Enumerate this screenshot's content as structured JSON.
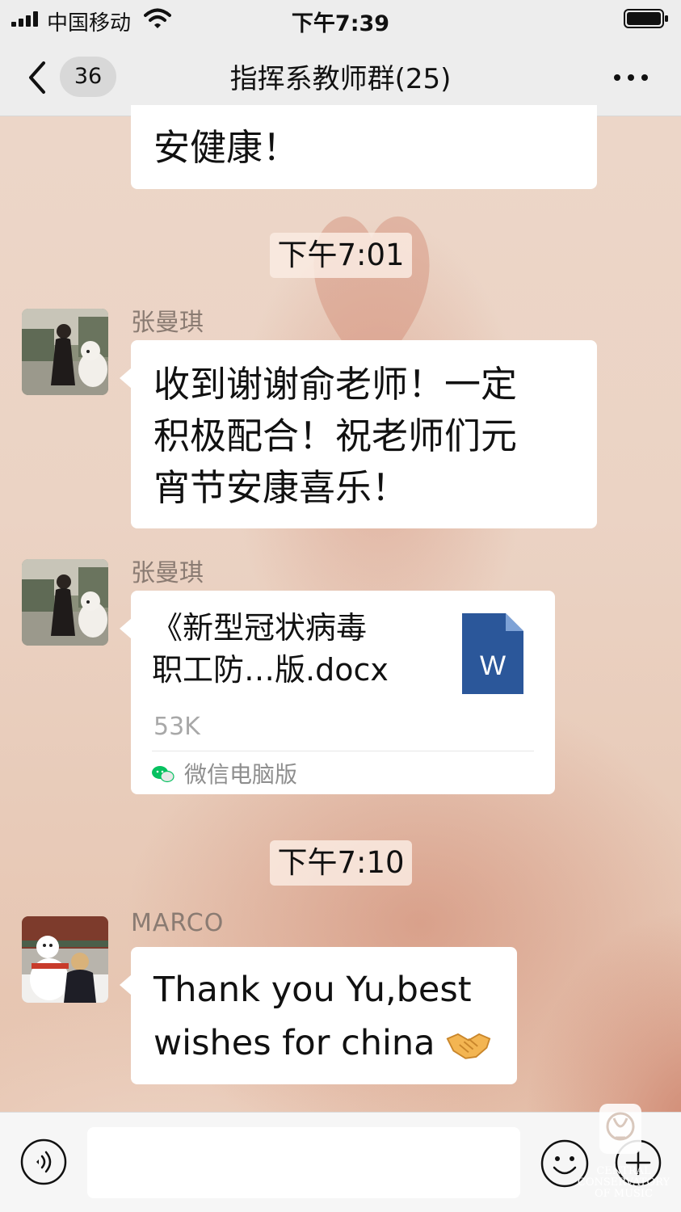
{
  "status_bar": {
    "carrier": "中国移动",
    "time": "下午7:39"
  },
  "nav": {
    "back_count": "36",
    "title": "指挥系教师群(25)"
  },
  "messages": [
    {
      "type": "text",
      "text": "安健康！"
    },
    {
      "type": "time",
      "text": "下午7:01"
    },
    {
      "type": "text",
      "sender": "张曼琪",
      "lines": [
        "收到谢谢俞老师！一定",
        "积极配合！祝老师们元",
        "宵节安康喜乐！"
      ]
    },
    {
      "type": "file",
      "sender": "张曼琪",
      "file_name_lines": [
        "《新型冠状病毒",
        "职工防…版.docx"
      ],
      "file_size": "53K",
      "source": "微信电脑版",
      "file_icon": "word-doc-icon",
      "file_icon_letter": "W",
      "file_icon_color": "#2b579a"
    },
    {
      "type": "time",
      "text": "下午7:10"
    },
    {
      "type": "text",
      "sender": "MARCO",
      "lines": [
        "Thank you Yu,best",
        "wishes for china"
      ],
      "emoji": "handshake-emoji"
    }
  ],
  "input_bar": {
    "voice_icon": "voice-icon",
    "emoji_icon": "emoji-icon",
    "plus_icon": "plus-icon"
  },
  "watermark": {
    "text": "CENTRAL CONSERVATORY OF MUSIC"
  },
  "colors": {
    "nav_bg": "#ededed",
    "bubble_bg": "#ffffff",
    "sender_name": "#8a7b72",
    "wechat_green": "#07c160"
  }
}
